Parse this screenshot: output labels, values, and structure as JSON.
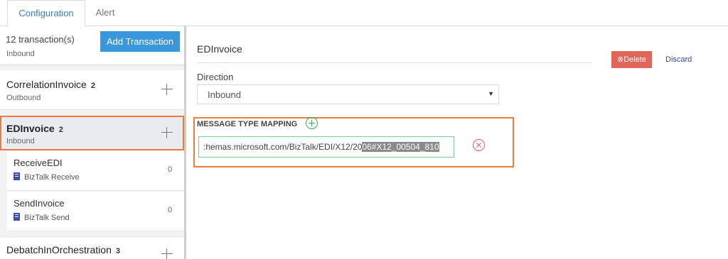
{
  "tabs": [
    {
      "label": "Configuration",
      "active": true
    },
    {
      "label": "Alert",
      "active": false
    }
  ],
  "left": {
    "count": "12 transaction(s)",
    "add_label": "Add Transaction",
    "cut_item_sub": "Inbound",
    "groups": [
      {
        "title": "CorrelationInvoice",
        "badge": "2",
        "sub": "Outbound"
      },
      {
        "title": "EDInvoice",
        "badge": "2",
        "sub": "Inbound",
        "selected": true
      },
      {
        "title": "DebatchInOrchestration",
        "badge": "3"
      }
    ],
    "children": [
      {
        "title": "ReceiveEDI",
        "sub": "BizTalk Receive",
        "value": "0"
      },
      {
        "title": "SendInvoice",
        "sub": "BizTalk Send",
        "value": "0"
      }
    ]
  },
  "right": {
    "title": "EDInvoice",
    "delete_label": "⊗Delete",
    "discard_label": "Discard",
    "direction_label": "Direction",
    "direction_value": "Inbound",
    "mapping_label": "MESSAGE TYPE MAPPING",
    "mapping_text_a": ":hemas.microsoft.com/BizTalk/EDI/X12/20",
    "mapping_text_b": "06#X12_00504_810"
  },
  "colors": {
    "accent": "#3a97dc",
    "highlight": "#f07a3c",
    "delete": "#e2655a"
  }
}
